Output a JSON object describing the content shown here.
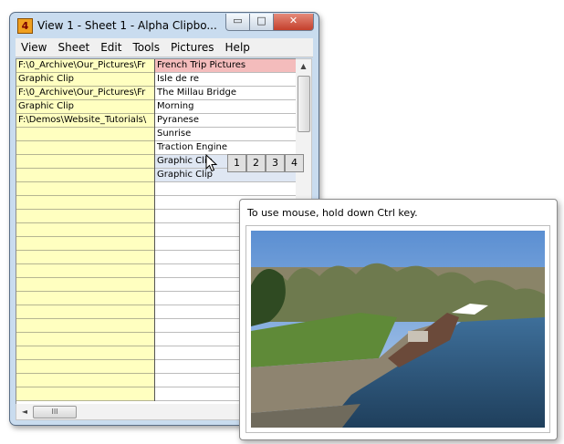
{
  "window": {
    "title": "View 1  -  Sheet 1  -  Alpha Clipbo...",
    "app_icon": "4",
    "min_symbol": "▭",
    "max_symbol": "□",
    "close_symbol": "✕"
  },
  "menu": [
    "View",
    "Sheet",
    "Edit",
    "Tools",
    "Pictures",
    "Help"
  ],
  "grid": {
    "col_a": [
      "F:\\0_Archive\\Our_Pictures\\Fr",
      "Graphic Clip",
      "F:\\0_Archive\\Our_Pictures\\Fr",
      "Graphic Clip",
      "F:\\Demos\\Website_Tutorials\\",
      "",
      "",
      "",
      "",
      "",
      "",
      "",
      "",
      "",
      "",
      "",
      "",
      "",
      "",
      "",
      "",
      "",
      "",
      "",
      ""
    ],
    "col_b": [
      "French Trip Pictures",
      "Isle de re",
      "The Millau Bridge",
      "Morning",
      "Pyranese",
      "Sunrise",
      "Traction Engine",
      "Graphic Clip",
      "Graphic Clip",
      "",
      "",
      "",
      "",
      "",
      "",
      "",
      "",
      "",
      "",
      "",
      "",
      "",
      "",
      "",
      ""
    ]
  },
  "clip_buttons": [
    "1",
    "2",
    "3",
    "4"
  ],
  "scroll": {
    "up": "▲",
    "down": "▼",
    "left": "◄",
    "right": "►",
    "grip": "III"
  },
  "popup": {
    "message": "To use mouse, hold down Ctrl key."
  },
  "colors": {
    "header_highlight": "#f4bcbc",
    "column_a_bg": "#ffffc0",
    "window_frame": "#c9dcef"
  }
}
